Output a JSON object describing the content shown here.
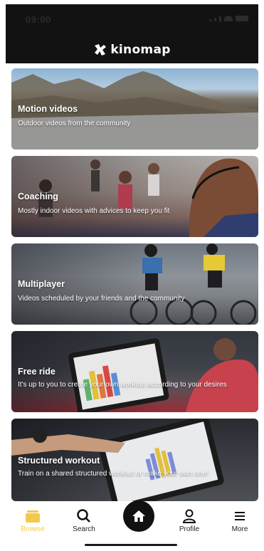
{
  "status_bar": {
    "time": "09:00"
  },
  "header": {
    "brand": "kinomap",
    "logo_icon": "kinomap-logo-icon"
  },
  "cards": [
    {
      "title": "Motion videos",
      "subtitle": "Outdoor videos from the community"
    },
    {
      "title": "Coaching",
      "subtitle": "Mostly indoor videos with advices to keep you fit"
    },
    {
      "title": "Multiplayer",
      "subtitle": "Videos scheduled by your friends and the community"
    },
    {
      "title": "Free ride",
      "subtitle": "It's up to you to create your own workout according to your desires"
    },
    {
      "title": "Structured workout",
      "subtitle": "Train on a shared structured workout or make your own one!"
    }
  ],
  "nav": {
    "browse": "Browse",
    "search": "Search",
    "profile": "Profile",
    "more": "More",
    "active_color": "#f2c94c",
    "icons": [
      "browse-icon",
      "search-icon",
      "home-icon",
      "profile-icon",
      "menu-icon"
    ]
  }
}
